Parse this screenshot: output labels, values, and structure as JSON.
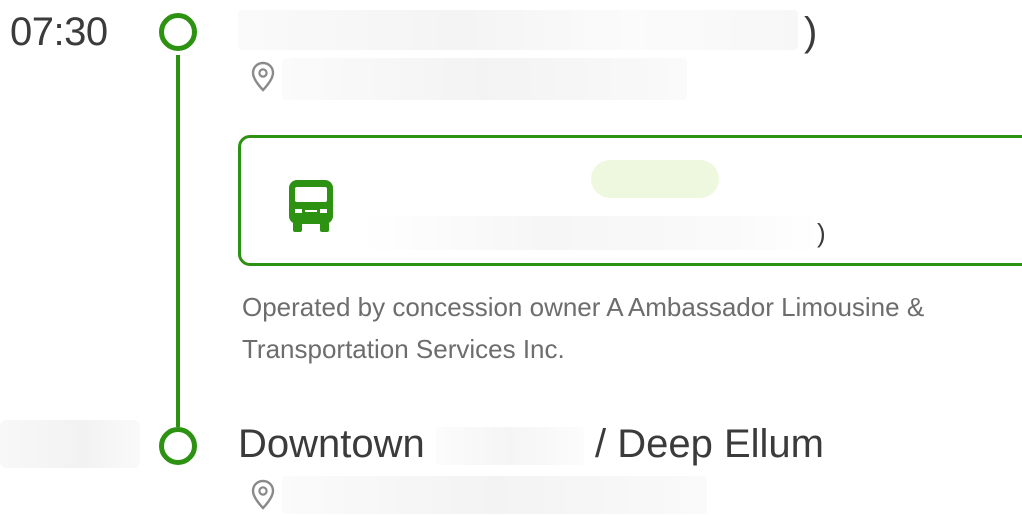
{
  "trip": {
    "start_time": "07:30",
    "start_stop": {
      "name_tail": ")"
    },
    "transit_leg": {
      "mode_icon": "bus-icon",
      "trailing_glyph": ")",
      "operator_note": "Operated by concession owner A Ambassador Limousine & Transportation Services Inc."
    },
    "end_stop": {
      "name_left": "Downtown",
      "name_right": "/ Deep Ellum"
    },
    "colors": {
      "accent": "#2d9212",
      "badge_bg": "#eef8de",
      "text_primary": "#3b3b3b",
      "text_secondary": "#6d6d6d"
    }
  }
}
